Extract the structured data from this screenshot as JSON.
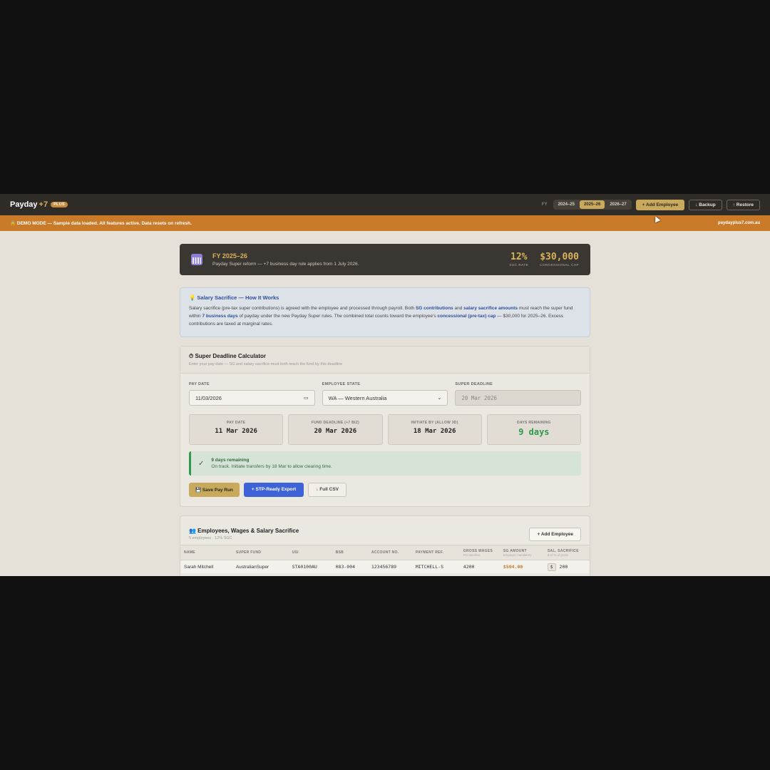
{
  "nav": {
    "brand": "Payday",
    "brand_accent": "+7",
    "badge": "PLUS",
    "fy_label": "FY",
    "fy_tabs": [
      "2024–25",
      "2025–26",
      "2026–27"
    ],
    "add_employee": "+ Add Employee",
    "backup": "↓ Backup",
    "restore": "↑ Restore"
  },
  "demo": {
    "text": "🔒 DEMO MODE — Sample data loaded. All features active. Data resets on refresh.",
    "site": "paydayplus7.com.au"
  },
  "fy_banner": {
    "title": "FY 2025–26",
    "subtitle": "Payday Super reform — +7 business day rule applies from 1 July 2026.",
    "sgc_rate": "12%",
    "sgc_label": "SGC RATE",
    "cap": "$30,000",
    "cap_label": "CONCESSIONAL CAP"
  },
  "info": {
    "title": "💡 Salary Sacrifice — How It Works",
    "p1": "Salary sacrifice (pre-tax super contributions) is agreed with the employee and processed through payroll. Both ",
    "b1": "SG contributions",
    "p2": " and ",
    "b2": "salary sacrifice amounts",
    "p3": " must reach the super fund within ",
    "b3": "7 business days",
    "p4": " of payday under the new Payday Super rules. The combined total counts toward the employee's ",
    "b4": "concessional (pre-tax) cap",
    "p5": " — $30,000 for 2025–26. Excess contributions are taxed at marginal rates."
  },
  "calc": {
    "title": "⏱ Super Deadline Calculator",
    "subtitle": "Enter your pay date — SG and salary sacrifice must both reach the fund by this deadline",
    "pay_date_label": "PAY DATE",
    "pay_date_value": "11/03/2026",
    "state_label": "EMPLOYEE STATE",
    "state_value": "WA — Western Australia",
    "deadline_label": "SUPER DEADLINE",
    "deadline_value": "20 Mar 2026",
    "boxes": [
      {
        "label": "PAY DATE",
        "value": "11 Mar 2026"
      },
      {
        "label": "FUND DEADLINE (+7 BIZ)",
        "value": "20 Mar 2026"
      },
      {
        "label": "INITIATE BY (ALLOW 3D)",
        "value": "18 Mar 2026"
      },
      {
        "label": "DAYS REMAINING",
        "value": "9 days"
      }
    ],
    "status_title": "9 days remaining",
    "status_sub": "On track. Initiate transfers by 18 Mar to allow clearing time.",
    "save_btn": "💾 Save Pay Run",
    "stp_btn": "+ STP-Ready Export",
    "csv_btn": "↓ Full CSV"
  },
  "employees": {
    "title": "👥 Employees, Wages & Salary Sacrifice",
    "subtitle": "5 employees · 12% SGC",
    "add_btn": "+ Add Employee",
    "columns": [
      {
        "label": "NAME",
        "sub": ""
      },
      {
        "label": "SUPER FUND",
        "sub": ""
      },
      {
        "label": "USI",
        "sub": ""
      },
      {
        "label": "BSB",
        "sub": ""
      },
      {
        "label": "ACCOUNT NO.",
        "sub": ""
      },
      {
        "label": "PAYMENT REF.",
        "sub": ""
      },
      {
        "label": "GROSS WAGES",
        "sub": "Pre-sacrifice"
      },
      {
        "label": "SG AMOUNT",
        "sub": "Employer mandatory"
      },
      {
        "label": "SAL. SACRIFICE",
        "sub": "$ or % of gross"
      }
    ],
    "rows": [
      {
        "name": "Sarah Mitchell",
        "fund": "AustralianSuper",
        "usi": "STA0100AU",
        "bsb": "083-004",
        "account": "123456789",
        "ref": "MITCHELL-S",
        "gross": "4200",
        "sg": "$504.00",
        "sac_unit": "$",
        "sac": "200"
      }
    ]
  }
}
